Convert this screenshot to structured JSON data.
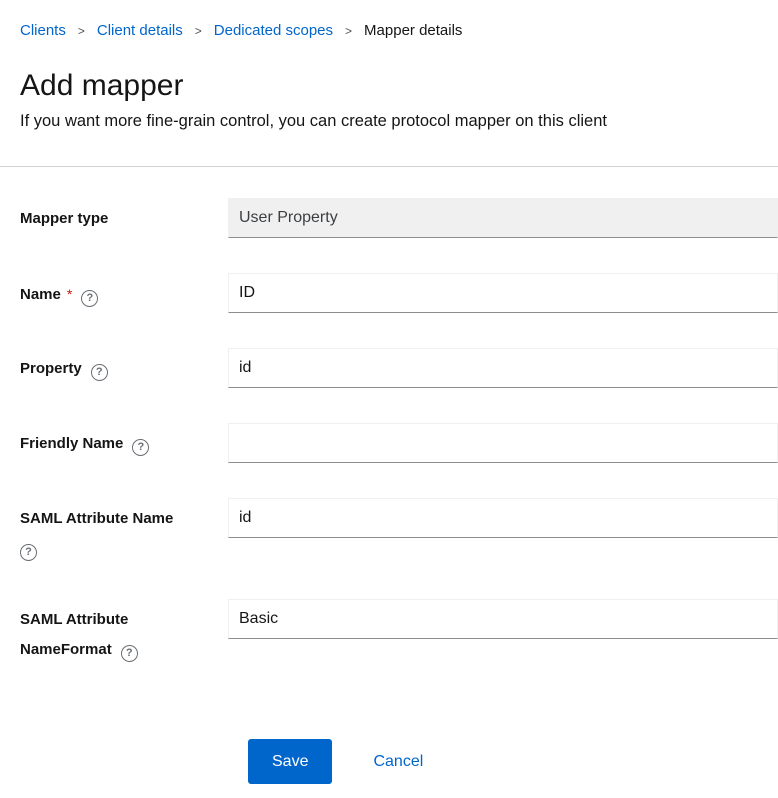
{
  "breadcrumb": {
    "separator": ">",
    "items": [
      {
        "label": "Clients",
        "link": true
      },
      {
        "label": "Client details",
        "link": true
      },
      {
        "label": "Dedicated scopes",
        "link": true
      },
      {
        "label": "Mapper details",
        "link": false
      }
    ]
  },
  "header": {
    "title": "Add mapper",
    "subtitle": "If you want more fine-grain control, you can create protocol mapper on this client"
  },
  "form": {
    "required_indicator": "*",
    "help_glyph": "?",
    "fields": [
      {
        "label": "Mapper type",
        "value": "User Property",
        "disabled": true,
        "required": false,
        "help": false
      },
      {
        "label": "Name",
        "value": "ID",
        "disabled": false,
        "required": true,
        "help": true
      },
      {
        "label": "Property",
        "value": "id",
        "disabled": false,
        "required": false,
        "help": true
      },
      {
        "label": "Friendly Name",
        "value": "",
        "disabled": false,
        "required": false,
        "help": true
      },
      {
        "label": "SAML Attribute Name",
        "value": "id",
        "disabled": false,
        "required": false,
        "help": true
      },
      {
        "label": "SAML Attribute NameFormat",
        "value": "Basic",
        "disabled": false,
        "required": false,
        "help": true
      }
    ]
  },
  "actions": {
    "save_label": "Save",
    "cancel_label": "Cancel"
  },
  "colors": {
    "link": "#0066cc",
    "primary_button": "#0066cc",
    "required_star": "#c9190b",
    "divider": "#d2d2d2",
    "input_border_bottom": "#8a8d90",
    "disabled_input_bg": "#f0f0f0",
    "text": "#151515",
    "help_icon": "#6a6e73"
  }
}
